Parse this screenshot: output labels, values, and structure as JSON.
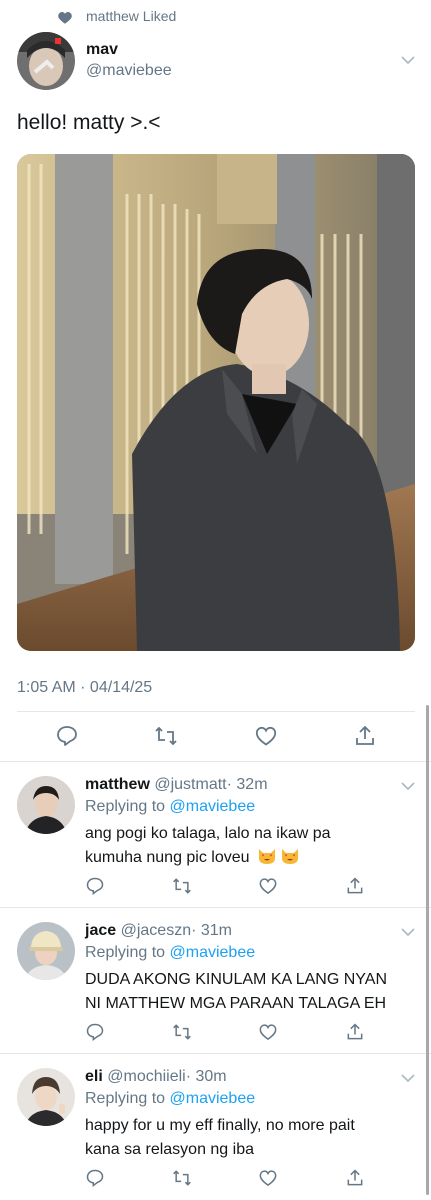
{
  "context": {
    "text": "matthew Liked",
    "icon": "heart-icon"
  },
  "tweet": {
    "name": "mav",
    "handle": "@maviebee",
    "text": "hello! matty >.<",
    "timestamp": "1:05 AM · 04/14/25",
    "photo_icon": "photo"
  },
  "actions": [
    "reply-icon",
    "retweet-icon",
    "like-icon",
    "share-icon"
  ],
  "replies": [
    {
      "name": "matthew",
      "handle": "@justmatt",
      "time": "· 32m",
      "replying_label": "Replying to",
      "replying_to": "@maviebee",
      "text_line1": "ang pogi ko talaga, lalo na ikaw pa",
      "text_line2": "kumuha nung pic loveu",
      "emojis": [
        "heart-eyes-cat-emoji",
        "heart-eyes-cat-emoji"
      ]
    },
    {
      "name": "jace",
      "handle": "@jaceszn",
      "time": "· 31m",
      "replying_label": "Replying to",
      "replying_to": "@maviebee",
      "text_line1": "DUDA AKONG KINULAM KA LANG NYAN",
      "text_line2": "NI MATTHEW MGA PARAAN TALAGA EH"
    },
    {
      "name": "eli",
      "handle": "@mochiieli",
      "time": "· 30m",
      "replying_label": "Replying to",
      "replying_to": "@maviebee",
      "text_line1": "happy for u my eff finally, no more pait",
      "text_line2": "kana sa relasyon ng iba"
    }
  ],
  "colors": {
    "link": "#1da1f2",
    "muted": "#657786",
    "divider": "#e1e8ed"
  }
}
